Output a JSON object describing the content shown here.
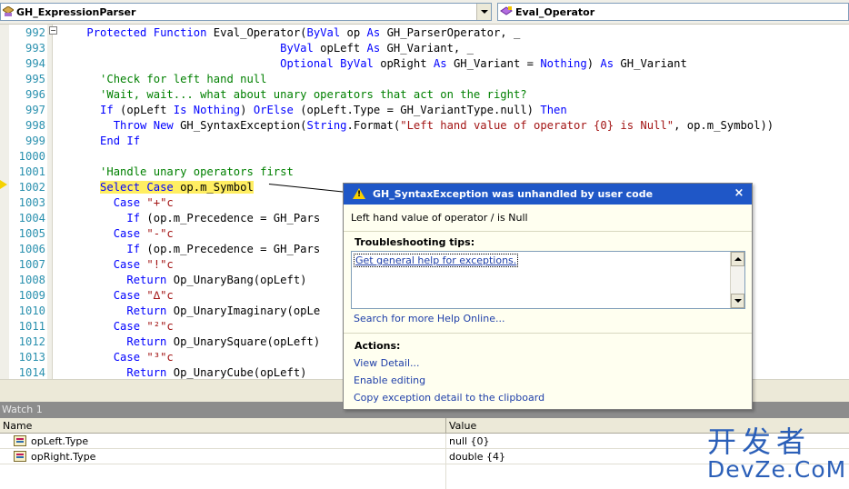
{
  "navbar": {
    "class_combo": "GH_ExpressionParser",
    "member_combo": "Eval_Operator"
  },
  "editor": {
    "lines": [
      {
        "num": "992",
        "segments": [
          {
            "t": "    ",
            "c": ""
          },
          {
            "t": "Protected Function",
            "c": "kw"
          },
          {
            "t": " Eval_Operator(",
            "c": ""
          },
          {
            "t": "ByVal",
            "c": "kw"
          },
          {
            "t": " op ",
            "c": ""
          },
          {
            "t": "As",
            "c": "kw"
          },
          {
            "t": " GH_ParserOperator, _",
            "c": ""
          }
        ]
      },
      {
        "num": "993",
        "segments": [
          {
            "t": "                                 ",
            "c": ""
          },
          {
            "t": "ByVal",
            "c": "kw"
          },
          {
            "t": " opLeft ",
            "c": ""
          },
          {
            "t": "As",
            "c": "kw"
          },
          {
            "t": " GH_Variant, _",
            "c": ""
          }
        ]
      },
      {
        "num": "994",
        "segments": [
          {
            "t": "                                 ",
            "c": ""
          },
          {
            "t": "Optional ByVal",
            "c": "kw"
          },
          {
            "t": " opRight ",
            "c": ""
          },
          {
            "t": "As",
            "c": "kw"
          },
          {
            "t": " GH_Variant = ",
            "c": ""
          },
          {
            "t": "Nothing",
            "c": "kw"
          },
          {
            "t": ") ",
            "c": ""
          },
          {
            "t": "As",
            "c": "kw"
          },
          {
            "t": " GH_Variant",
            "c": ""
          }
        ]
      },
      {
        "num": "995",
        "segments": [
          {
            "t": "      ",
            "c": ""
          },
          {
            "t": "'Check for left hand null",
            "c": "cm"
          }
        ]
      },
      {
        "num": "996",
        "segments": [
          {
            "t": "      ",
            "c": ""
          },
          {
            "t": "'Wait, wait... what about unary operators that act on the right?",
            "c": "cm"
          }
        ]
      },
      {
        "num": "997",
        "segments": [
          {
            "t": "      ",
            "c": ""
          },
          {
            "t": "If",
            "c": "kw"
          },
          {
            "t": " (opLeft ",
            "c": ""
          },
          {
            "t": "Is Nothing",
            "c": "kw"
          },
          {
            "t": ") ",
            "c": ""
          },
          {
            "t": "OrElse",
            "c": "kw"
          },
          {
            "t": " (opLeft.Type = GH_VariantType.null) ",
            "c": ""
          },
          {
            "t": "Then",
            "c": "kw"
          }
        ]
      },
      {
        "num": "998",
        "segments": [
          {
            "t": "        ",
            "c": ""
          },
          {
            "t": "Throw New",
            "c": "kw"
          },
          {
            "t": " GH_SyntaxException(",
            "c": ""
          },
          {
            "t": "String",
            "c": "kw"
          },
          {
            "t": ".Format(",
            "c": ""
          },
          {
            "t": "\"Left hand value of operator {0} is Null\"",
            "c": "st"
          },
          {
            "t": ", op.m_Symbol))",
            "c": ""
          }
        ]
      },
      {
        "num": "999",
        "segments": [
          {
            "t": "      ",
            "c": ""
          },
          {
            "t": "End If",
            "c": "kw"
          }
        ]
      },
      {
        "num": "1000",
        "segments": []
      },
      {
        "num": "1001",
        "segments": [
          {
            "t": "      ",
            "c": ""
          },
          {
            "t": "'Handle unary operators first",
            "c": "cm"
          }
        ]
      },
      {
        "num": "1002",
        "segments": [
          {
            "t": "      ",
            "c": ""
          },
          {
            "t": "Select Case",
            "c": "kw hl"
          },
          {
            "t": " op.m_Symbol",
            "c": "hl"
          }
        ]
      },
      {
        "num": "1003",
        "segments": [
          {
            "t": "        ",
            "c": ""
          },
          {
            "t": "Case",
            "c": "kw"
          },
          {
            "t": " ",
            "c": ""
          },
          {
            "t": "\"+\"c",
            "c": "st"
          }
        ]
      },
      {
        "num": "1004",
        "segments": [
          {
            "t": "          ",
            "c": ""
          },
          {
            "t": "If",
            "c": "kw"
          },
          {
            "t": " (op.m_Precedence = GH_Pars",
            "c": ""
          }
        ]
      },
      {
        "num": "1005",
        "segments": [
          {
            "t": "        ",
            "c": ""
          },
          {
            "t": "Case",
            "c": "kw"
          },
          {
            "t": " ",
            "c": ""
          },
          {
            "t": "\"-\"c",
            "c": "st"
          }
        ]
      },
      {
        "num": "1006",
        "segments": [
          {
            "t": "          ",
            "c": ""
          },
          {
            "t": "If",
            "c": "kw"
          },
          {
            "t": " (op.m_Precedence = GH_Pars",
            "c": ""
          }
        ]
      },
      {
        "num": "1007",
        "segments": [
          {
            "t": "        ",
            "c": ""
          },
          {
            "t": "Case",
            "c": "kw"
          },
          {
            "t": " ",
            "c": ""
          },
          {
            "t": "\"!\"c",
            "c": "st"
          }
        ]
      },
      {
        "num": "1008",
        "segments": [
          {
            "t": "          ",
            "c": ""
          },
          {
            "t": "Return",
            "c": "kw"
          },
          {
            "t": " Op_UnaryBang(opLeft)",
            "c": ""
          }
        ]
      },
      {
        "num": "1009",
        "segments": [
          {
            "t": "        ",
            "c": ""
          },
          {
            "t": "Case",
            "c": "kw"
          },
          {
            "t": " ",
            "c": ""
          },
          {
            "t": "\"∆\"c",
            "c": "st"
          }
        ]
      },
      {
        "num": "1010",
        "segments": [
          {
            "t": "          ",
            "c": ""
          },
          {
            "t": "Return",
            "c": "kw"
          },
          {
            "t": " Op_UnaryImaginary(opLe",
            "c": ""
          }
        ]
      },
      {
        "num": "1011",
        "segments": [
          {
            "t": "        ",
            "c": ""
          },
          {
            "t": "Case",
            "c": "kw"
          },
          {
            "t": " ",
            "c": ""
          },
          {
            "t": "\"²\"c",
            "c": "st"
          }
        ]
      },
      {
        "num": "1012",
        "segments": [
          {
            "t": "          ",
            "c": ""
          },
          {
            "t": "Return",
            "c": "kw"
          },
          {
            "t": " Op_UnarySquare(opLeft)",
            "c": ""
          }
        ]
      },
      {
        "num": "1013",
        "segments": [
          {
            "t": "        ",
            "c": ""
          },
          {
            "t": "Case",
            "c": "kw"
          },
          {
            "t": " ",
            "c": ""
          },
          {
            "t": "\"³\"c",
            "c": "st"
          }
        ]
      },
      {
        "num": "1014",
        "segments": [
          {
            "t": "          ",
            "c": ""
          },
          {
            "t": "Return",
            "c": "kw"
          },
          {
            "t": " Op_UnaryCube(opLeft)",
            "c": ""
          }
        ]
      }
    ]
  },
  "exception": {
    "title": "GH_SyntaxException was unhandled by user code",
    "close_glyph": "×",
    "message": "Left hand value of operator / is Null",
    "tips_heading": "Troubleshooting tips:",
    "tip_link": "Get general help for exceptions.",
    "search_link": "Search for more Help Online...",
    "actions_heading": "Actions:",
    "actions": [
      "View Detail...",
      "Enable editing",
      "Copy exception detail to the clipboard"
    ]
  },
  "watch": {
    "title": "Watch 1",
    "columns": [
      "Name",
      "Value"
    ],
    "rows": [
      {
        "name": "opLeft.Type",
        "value": "null {0}"
      },
      {
        "name": "opRight.Type",
        "value": "double {4}"
      }
    ]
  },
  "watermark": {
    "cn": "开发者",
    "en": "DevZe.CoM"
  },
  "icons": {
    "class_combo_icon": "class-icon",
    "member_combo_icon": "method-icon",
    "warning": "warning-icon",
    "watch_row_icon": "property-icon",
    "current_statement": "current-statement-arrow-icon"
  },
  "colors": {
    "keyword": "#0000ff",
    "comment": "#008000",
    "string": "#a31515",
    "line_number": "#2b91af",
    "highlight": "#ffee62",
    "exception_title": "#1f57c7"
  }
}
